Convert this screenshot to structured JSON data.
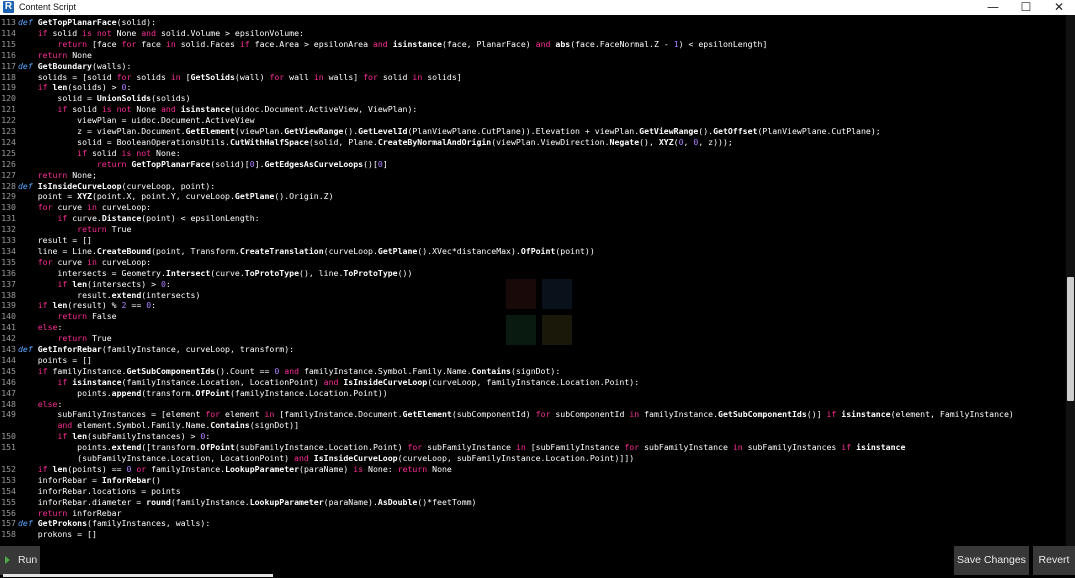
{
  "window": {
    "icon_letter": "R",
    "title": "Content Script",
    "minimize_glyph": "—",
    "maximize_glyph": "☐",
    "close_glyph": "✕"
  },
  "editor": {
    "lines": [
      {
        "n": "113",
        "html": "<span class=\"def\">def</span> <span class=\"fn\">GetTopPlanarFace</span>(solid):"
      },
      {
        "n": "114",
        "html": "    <span class=\"kw\">if</span> solid <span class=\"kw\">is not</span> None <span class=\"kw\">and</span> solid.Volume &gt; epsilonVolume:"
      },
      {
        "n": "115",
        "html": "        <span class=\"kw\">return</span> [face <span class=\"kw\">for</span> face <span class=\"kw\">in</span> solid.Faces <span class=\"kw\">if</span> face.Area &gt; epsilonArea <span class=\"kw\">and</span> <span class=\"fn\">isinstance</span>(face, PlanarFace) <span class=\"kw\">and</span> <span class=\"fn\">abs</span>(face.FaceNormal.Z - <span class=\"num\">1</span>) &lt; epsilonLength]"
      },
      {
        "n": "116",
        "html": "    <span class=\"kw\">return</span> None"
      },
      {
        "n": "117",
        "html": "<span class=\"def\">def</span> <span class=\"fn\">GetBoundary</span>(walls):"
      },
      {
        "n": "118",
        "html": "    solids = [solid <span class=\"kw\">for</span> solids <span class=\"kw\">in</span> [<span class=\"fn\">GetSolids</span>(wall) <span class=\"kw\">for</span> wall <span class=\"kw\">in</span> walls] <span class=\"kw\">for</span> solid <span class=\"kw\">in</span> solids]"
      },
      {
        "n": "119",
        "html": "    <span class=\"kw\">if</span> <span class=\"fn\">len</span>(solids) &gt; <span class=\"num\">0</span>:"
      },
      {
        "n": "120",
        "html": "        solid = <span class=\"fn\">UnionSolids</span>(solids)"
      },
      {
        "n": "121",
        "html": "        <span class=\"kw\">if</span> solid <span class=\"kw\">is not</span> None <span class=\"kw\">and</span> <span class=\"fn\">isinstance</span>(uidoc.Document.ActiveView, ViewPlan):"
      },
      {
        "n": "122",
        "html": "            viewPlan = uidoc.Document.ActiveView"
      },
      {
        "n": "123",
        "html": "            z = viewPlan.Document.<span class=\"fn\">GetElement</span>(viewPlan.<span class=\"fn\">GetViewRange</span>().<span class=\"fn\">GetLevelId</span>(PlanViewPlane.CutPlane)).Elevation + viewPlan.<span class=\"fn\">GetViewRange</span>().<span class=\"fn\">GetOffset</span>(PlanViewPlane.CutPlane);"
      },
      {
        "n": "124",
        "html": "            solid = BooleanOperationsUtils.<span class=\"fn\">CutWithHalfSpace</span>(solid, Plane.<span class=\"fn\">CreateByNormalAndOrigin</span>(viewPlan.ViewDirection.<span class=\"fn\">Negate</span>(), <span class=\"fn\">XYZ</span>(<span class=\"num\">0</span>, <span class=\"num\">0</span>, z)));"
      },
      {
        "n": "125",
        "html": "            <span class=\"kw\">if</span> solid <span class=\"kw\">is not</span> None:"
      },
      {
        "n": "126",
        "html": "                <span class=\"kw\">return</span> <span class=\"fn\">GetTopPlanarFace</span>(solid)[<span class=\"num\">0</span>].<span class=\"fn\">GetEdgesAsCurveLoops</span>()[<span class=\"num\">0</span>]"
      },
      {
        "n": "127",
        "html": "    <span class=\"kw\">return</span> None;"
      },
      {
        "n": "128",
        "html": "<span class=\"def\">def</span> <span class=\"fn\">IsInsideCurveLoop</span>(curveLoop, point):"
      },
      {
        "n": "129",
        "html": "    point = <span class=\"fn\">XYZ</span>(point.X, point.Y, curveLoop.<span class=\"fn\">GetPlane</span>().Origin.Z)"
      },
      {
        "n": "130",
        "html": "    <span class=\"kw\">for</span> curve <span class=\"kw\">in</span> curveLoop:"
      },
      {
        "n": "131",
        "html": "        <span class=\"kw\">if</span> curve.<span class=\"fn\">Distance</span>(point) &lt; epsilonLength:"
      },
      {
        "n": "132",
        "html": "            <span class=\"kw\">return</span> True"
      },
      {
        "n": "133",
        "html": "    result = []"
      },
      {
        "n": "134",
        "html": "    line = Line.<span class=\"fn\">CreateBound</span>(point, Transform.<span class=\"fn\">CreateTranslation</span>(curveLoop.<span class=\"fn\">GetPlane</span>().XVec*distanceMax).<span class=\"fn\">OfPoint</span>(point))"
      },
      {
        "n": "135",
        "html": "    <span class=\"kw\">for</span> curve <span class=\"kw\">in</span> curveLoop:"
      },
      {
        "n": "136",
        "html": "        intersects = Geometry.<span class=\"fn\">Intersect</span>(curve.<span class=\"fn\">ToProtoType</span>(), line.<span class=\"fn\">ToProtoType</span>())"
      },
      {
        "n": "137",
        "html": "        <span class=\"kw\">if</span> <span class=\"fn\">len</span>(intersects) &gt; <span class=\"num\">0</span>:"
      },
      {
        "n": "138",
        "html": "            result.<span class=\"fn\">extend</span>(intersects)"
      },
      {
        "n": "139",
        "html": "    <span class=\"kw\">if</span> <span class=\"fn\">len</span>(result) % <span class=\"num\">2</span> == <span class=\"num\">0</span>:"
      },
      {
        "n": "140",
        "html": "        <span class=\"kw\">return</span> False"
      },
      {
        "n": "141",
        "html": "    <span class=\"kw\">else</span>:"
      },
      {
        "n": "142",
        "html": "        <span class=\"kw\">return</span> True"
      },
      {
        "n": "143",
        "html": "<span class=\"def\">def</span> <span class=\"fn\">GetInforRebar</span>(familyInstance, curveLoop, transform):"
      },
      {
        "n": "144",
        "html": "    points = []"
      },
      {
        "n": "145",
        "html": "    <span class=\"kw\">if</span> familyInstance.<span class=\"fn\">GetSubComponentIds</span>().Count == <span class=\"num\">0</span> <span class=\"kw\">and</span> familyInstance.Symbol.Family.Name.<span class=\"fn\">Contains</span>(signDot):"
      },
      {
        "n": "146",
        "html": "        <span class=\"kw\">if</span> <span class=\"fn\">isinstance</span>(familyInstance.Location, LocationPoint) <span class=\"kw\">and</span> <span class=\"fn\">IsInsideCurveLoop</span>(curveLoop, familyInstance.Location.Point):"
      },
      {
        "n": "147",
        "html": "            points.<span class=\"fn\">append</span>(transform.<span class=\"fn\">OfPoint</span>(familyInstance.Location.Point))"
      },
      {
        "n": "148",
        "html": "    <span class=\"kw\">else</span>:"
      },
      {
        "n": "149",
        "html": "        subFamilyInstances = [element <span class=\"kw\">for</span> element <span class=\"kw\">in</span> [familyInstance.Document.<span class=\"fn\">GetElement</span>(subComponentId) <span class=\"kw\">for</span> subComponentId <span class=\"kw\">in</span> familyInstance.<span class=\"fn\">GetSubComponentIds</span>()] <span class=\"kw\">if</span> <span class=\"fn\">isinstance</span>(element, FamilyInstance)"
      },
      {
        "n": "",
        "html": "        <span class=\"kw\">and</span> element.Symbol.Family.Name.<span class=\"fn\">Contains</span>(signDot)]"
      },
      {
        "n": "150",
        "html": "        <span class=\"kw\">if</span> <span class=\"fn\">len</span>(subFamilyInstances) &gt; <span class=\"num\">0</span>:"
      },
      {
        "n": "151",
        "html": "            points.<span class=\"fn\">extend</span>([transform.<span class=\"fn\">OfPoint</span>(subFamilyInstance.Location.Point) <span class=\"kw\">for</span> subFamilyInstance <span class=\"kw\">in</span> [subFamilyInstance <span class=\"kw\">for</span> subFamilyInstance <span class=\"kw\">in</span> subFamilyInstances <span class=\"kw\">if</span> <span class=\"fn\">isinstance</span>"
      },
      {
        "n": "",
        "html": "            (subFamilyInstance.Location, LocationPoint) <span class=\"kw\">and</span> <span class=\"fn\">IsInsideCurveLoop</span>(curveLoop, subFamilyInstance.Location.Point)]])"
      },
      {
        "n": "152",
        "html": "    <span class=\"kw\">if</span> <span class=\"fn\">len</span>(points) == <span class=\"num\">0</span> <span class=\"kw\">or</span> familyInstance.<span class=\"fn\">LookupParameter</span>(paraName) <span class=\"kw\">is</span> None: <span class=\"kw\">return</span> None"
      },
      {
        "n": "153",
        "html": "    inforRebar = <span class=\"fn\">InforRebar</span>()"
      },
      {
        "n": "154",
        "html": "    inforRebar.locations = points"
      },
      {
        "n": "155",
        "html": "    inforRebar.diameter = <span class=\"fn\">round</span>(familyInstance.<span class=\"fn\">LookupParameter</span>(paraName).<span class=\"fn\">AsDouble</span>()*feetTomm)"
      },
      {
        "n": "156",
        "html": "    <span class=\"kw\">return</span> inforRebar"
      },
      {
        "n": "157",
        "html": "<span class=\"def\">def</span> <span class=\"fn\">GetProkons</span>(familyInstances, walls):"
      },
      {
        "n": "158",
        "html": "    prokons = []"
      }
    ]
  },
  "footer": {
    "run_label": "Run",
    "save_label": "Save Changes",
    "revert_label": "Revert"
  },
  "colors": {
    "keyword": "#ff2d95",
    "def": "#56a6ff",
    "number": "#ae81ff",
    "background": "#000000",
    "button": "#383838",
    "play": "#4ca64c"
  }
}
